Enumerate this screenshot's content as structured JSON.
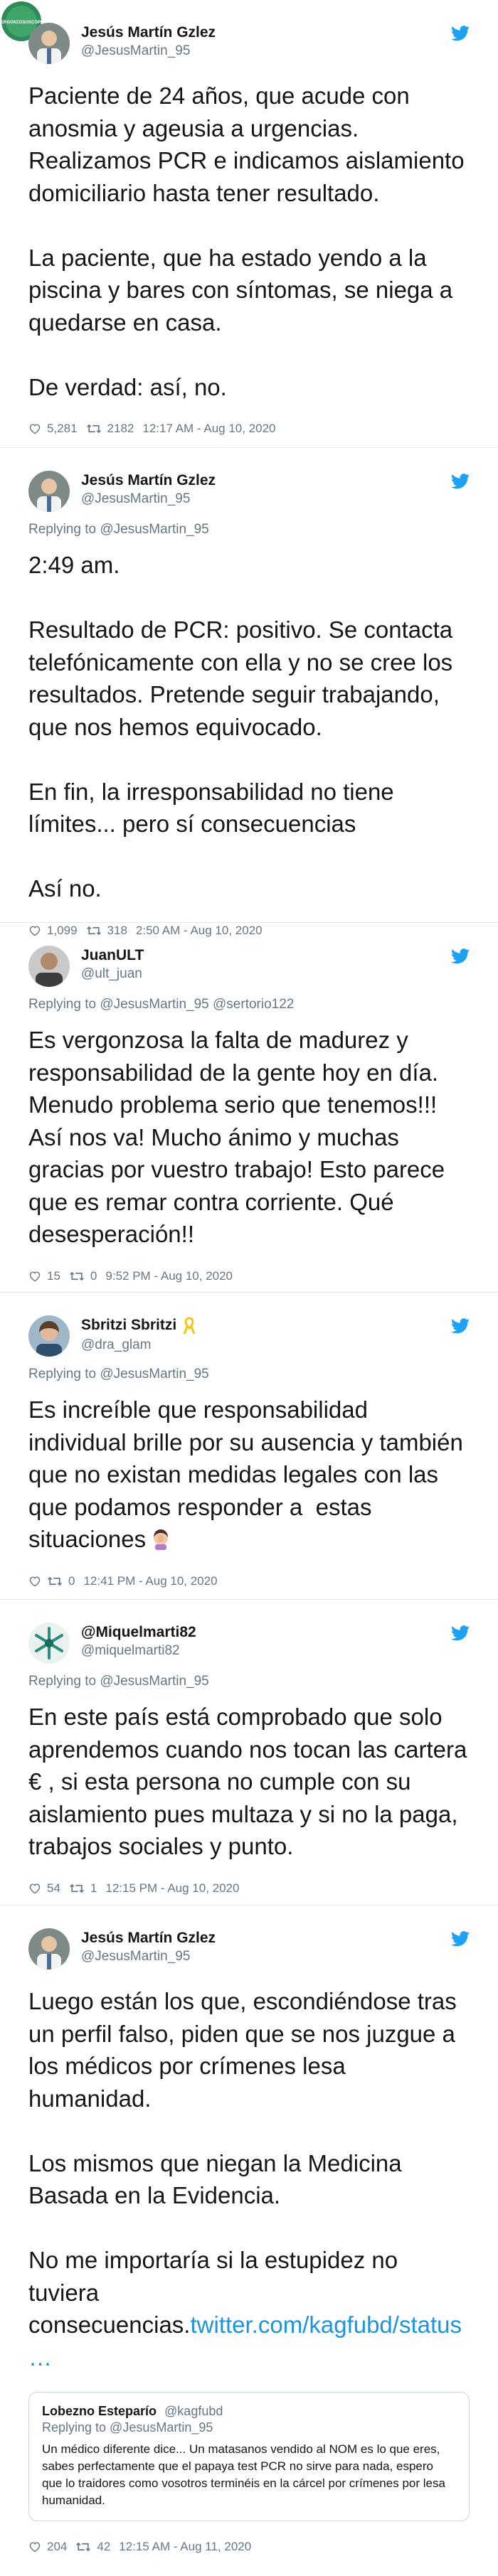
{
  "colors": {
    "twitter_blue": "#1da1f2",
    "link": "#1b95e0",
    "muted": "#657786",
    "border": "#e1e8ed",
    "badge_green": "#2e8b57"
  },
  "corner_badge": {
    "text": "VERGONZOSOSCOPIA"
  },
  "tweets": [
    {
      "name": "Jesús Martín Gzlez",
      "handle": "@JesusMartin_95",
      "reply_to": "",
      "body": "Paciente de 24 años, que acude con anosmia y ageusia a urgencias. Realizamos PCR e indicamos aislamiento domiciliario hasta tener resultado.\n\nLa paciente, que ha estado yendo a la piscina y bares con síntomas, se niega a quedarse en casa.\n\nDe verdad: así, no.",
      "likes": "5,281",
      "retweets": "2182",
      "timestamp": "12:17 AM - Aug 10, 2020",
      "avatar_icon": "doctor-avatar"
    },
    {
      "name": "Jesús Martín Gzlez",
      "handle": "@JesusMartin_95",
      "reply_to": "Replying to @JesusMartin_95",
      "body": "2:49 am.\n\nResultado de PCR: positivo. Se contacta telefónicamente con ella y no se cree los resultados. Pretende seguir trabajando, que nos hemos equivocado.\n\nEn fin, la irresponsabilidad no tiene límites... pero sí consecuencias\n\nAsí no.",
      "likes": "1,099",
      "retweets": "318",
      "timestamp": "2:50 AM - Aug 10, 2020",
      "avatar_icon": "doctor-avatar"
    },
    {
      "name": "JuanULT",
      "handle": "@ult_juan",
      "reply_to": "Replying to @JesusMartin_95 @sertorio122",
      "body": "Es vergonzosa la falta de madurez y responsabilidad de la gente hoy en día. Menudo problema serio que tenemos!!! Así nos va! Mucho ánimo y muchas gracias por vuestro trabajo! Esto parece que es remar contra corriente. Qué desesperación!!",
      "likes": "15",
      "retweets": "0",
      "timestamp": "9:52 PM - Aug 10, 2020",
      "avatar_icon": "person-avatar"
    },
    {
      "name": "Sbritzi Sbritzi",
      "handle": "@dra_glam",
      "reply_to": "Replying to @JesusMartin_95",
      "body": "Es increíble que responsabilidad individual brille por su ausencia y también que no existan medidas legales con las que podamos responder a  estas situaciones",
      "likes": "",
      "retweets": "0",
      "timestamp": "12:41 PM - Aug 10, 2020",
      "avatar_icon": "woman-avatar",
      "has_ribbon": true,
      "has_emoji": true
    },
    {
      "name": "@Miquelmarti82",
      "handle": "@miquelmarti82",
      "reply_to": "Replying to @JesusMartin_95",
      "body": "En este país está comprobado que solo aprendemos cuando nos tocan las cartera € , si esta persona no cumple con su aislamiento pues multaza y si no la paga, trabajos sociales y punto.",
      "likes": "54",
      "retweets": "1",
      "timestamp": "12:15 PM - Aug 10, 2020",
      "avatar_icon": "snowflake-avatar"
    },
    {
      "name": "Jesús Martín Gzlez",
      "handle": "@JesusMartin_95",
      "reply_to": "",
      "body": "Luego están los que, escondiéndose tras un perfil falso, piden que se nos juzgue a los médicos por crímenes lesa humanidad.\n\nLos mismos que niegan la Medicina Basada en la Evidencia.\n\nNo me importaría si la estupidez no tuviera consecuencias.",
      "link": "twitter.com/kagfubd/status\n…",
      "likes": "204",
      "retweets": "42",
      "timestamp": "12:15 AM - Aug 11, 2020",
      "avatar_icon": "doctor-avatar",
      "quote": {
        "name": "Lobezno Esteparío",
        "handle": "@kagfubd",
        "reply_to": "Replying to @JesusMartin_95",
        "body": "Un médico diferente dice... Un matasanos vendido al NOM es lo que eres, sabes perfectamente que el papaya test PCR no sirve para nada, espero que lo traidores como vosotros terminéis en la cárcel por crímenes por lesa humanidad."
      }
    }
  ]
}
